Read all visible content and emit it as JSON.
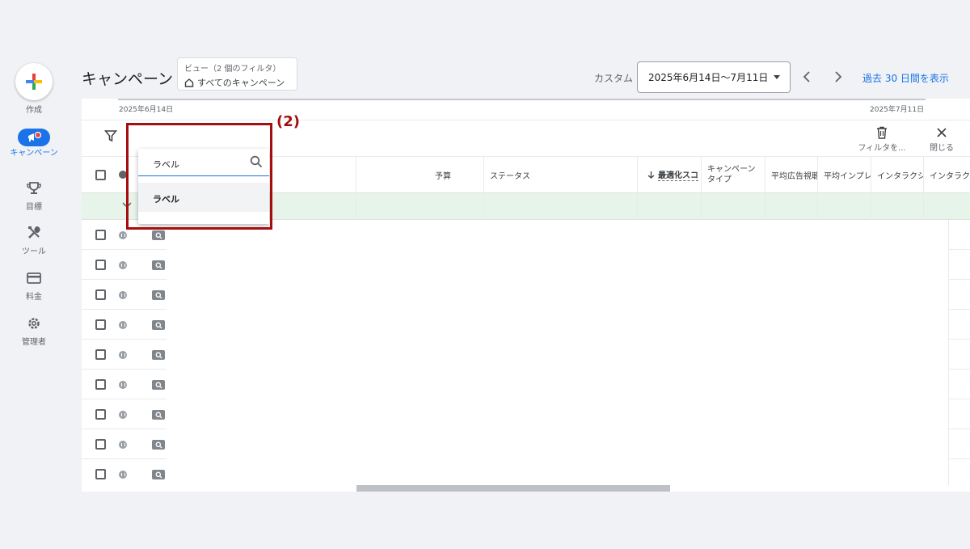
{
  "nav": {
    "create": "作成",
    "campaigns": "キャンペーン",
    "goals": "目標",
    "tools": "ツール",
    "billing": "料金",
    "admin": "管理者"
  },
  "header": {
    "title": "キャンペーン",
    "view_sub": "ビュー（2 個のフィルタ）",
    "view_main": "すべてのキャンペーン",
    "custom_label": "カスタム",
    "date_range": "2025年6月14日〜7月11日",
    "last30": "過去 30 日間を表示"
  },
  "timeline": {
    "start": "2025年6月14日",
    "end": "2025年7月11日"
  },
  "toolbar": {
    "delete_filter": "フィルタを...",
    "close": "閉じる"
  },
  "columns": [
    "予算",
    "ステータス",
    "最適化スコ",
    "キャンペーン タイプ",
    "平均広告視聴",
    "平均インプレ",
    "インタラクシ",
    "インタラクシ"
  ],
  "dropdown": {
    "input_value": "ラベル",
    "option": "ラベル"
  },
  "annotation": "(2)",
  "colors": {
    "accent": "#1a73e8",
    "highlight": "#a50e0e",
    "total_row": "#e6f4ea"
  }
}
